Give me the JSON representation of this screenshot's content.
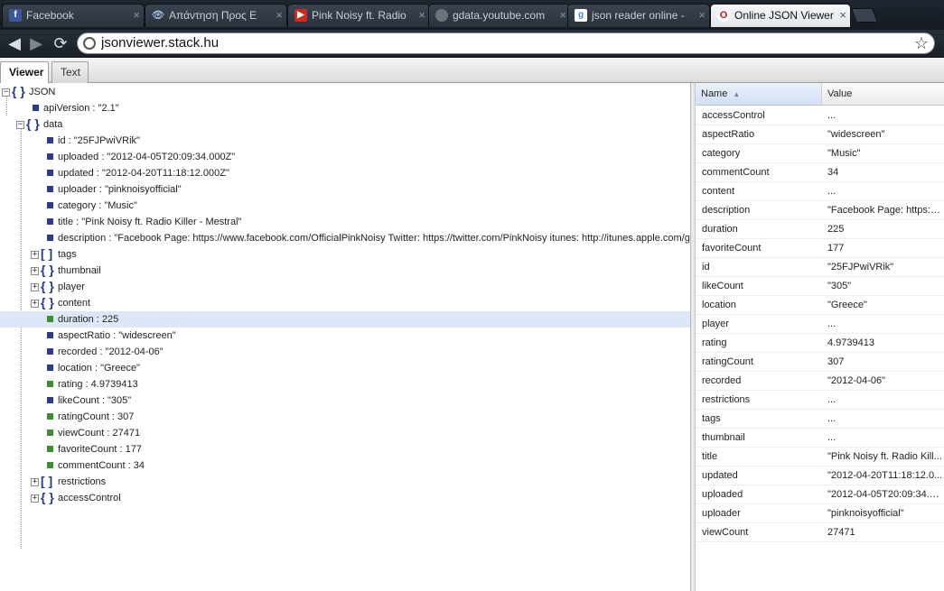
{
  "browser": {
    "tabs": [
      {
        "title": "Facebook",
        "icon": "facebook-icon"
      },
      {
        "title": "Απάντηση Προς Ε",
        "icon": "eye-icon"
      },
      {
        "title": "Pink Noisy ft. Radio",
        "icon": "youtube-icon"
      },
      {
        "title": "gdata.youtube.com",
        "icon": "globe-icon"
      },
      {
        "title": "json reader online -",
        "icon": "google-icon"
      },
      {
        "title": "Online JSON Viewer",
        "icon": "opera-icon"
      }
    ],
    "close_glyph": "×",
    "url": "jsonviewer.stack.hu"
  },
  "app": {
    "tabs": [
      {
        "label": "Viewer",
        "active": true
      },
      {
        "label": "Text",
        "active": false
      }
    ]
  },
  "tree": {
    "rows": [
      {
        "toggle": "⊟",
        "icon": "{}",
        "text": "JSON",
        "indent": 0
      },
      {
        "leaf": "str",
        "text": "apiVersion : \"2.1\"",
        "indent": 1
      },
      {
        "toggle": "⊟",
        "icon": "{}",
        "text": "data",
        "indent": 1
      },
      {
        "leaf": "str",
        "text": "id : \"25FJPwiVRik\"",
        "indent": 2
      },
      {
        "leaf": "str",
        "text": "uploaded : \"2012-04-05T20:09:34.000Z\"",
        "indent": 2
      },
      {
        "leaf": "str",
        "text": "updated : \"2012-04-20T11:18:12.000Z\"",
        "indent": 2
      },
      {
        "leaf": "str",
        "text": "uploader : \"pinknoisyofficial\"",
        "indent": 2
      },
      {
        "leaf": "str",
        "text": "category : \"Music\"",
        "indent": 2
      },
      {
        "leaf": "str",
        "text": "title : \"Pink Noisy ft. Radio Killer - Mestral\"",
        "indent": 2
      },
      {
        "leaf": "str",
        "text": "description : \"Facebook Page: https://www.facebook.com/OfficialPinkNoisy Twitter: https://twitter.com/PinkNoisy itunes: http://itunes.apple.com/gr",
        "indent": 2
      },
      {
        "toggle": "⊞",
        "icon": "[]",
        "text": "tags",
        "indent": 2
      },
      {
        "toggle": "⊞",
        "icon": "{}",
        "text": "thumbnail",
        "indent": 2
      },
      {
        "toggle": "⊞",
        "icon": "{}",
        "text": "player",
        "indent": 2
      },
      {
        "toggle": "⊞",
        "icon": "{}",
        "text": "content",
        "indent": 2
      },
      {
        "leaf": "num",
        "text": "duration : 225",
        "indent": 2,
        "selected": true
      },
      {
        "leaf": "str",
        "text": "aspectRatio : \"widescreen\"",
        "indent": 2
      },
      {
        "leaf": "str",
        "text": "recorded : \"2012-04-06\"",
        "indent": 2
      },
      {
        "leaf": "str",
        "text": "location : \"Greece\"",
        "indent": 2
      },
      {
        "leaf": "num",
        "text": "rating : 4.9739413",
        "indent": 2
      },
      {
        "leaf": "str",
        "text": "likeCount : \"305\"",
        "indent": 2
      },
      {
        "leaf": "num",
        "text": "ratingCount : 307",
        "indent": 2
      },
      {
        "leaf": "num",
        "text": "viewCount : 27471",
        "indent": 2
      },
      {
        "leaf": "num",
        "text": "favoriteCount : 177",
        "indent": 2
      },
      {
        "leaf": "num",
        "text": "commentCount : 34",
        "indent": 2
      },
      {
        "toggle": "⊞",
        "icon": "[]",
        "text": "restrictions",
        "indent": 2
      },
      {
        "toggle": "⊞",
        "icon": "{}",
        "text": "accessControl",
        "indent": 2
      }
    ]
  },
  "grid": {
    "header": {
      "name": "Name",
      "sort_glyph": "▲",
      "value": "Value"
    },
    "rows": [
      {
        "name": "accessControl",
        "value": "..."
      },
      {
        "name": "aspectRatio",
        "value": "\"widescreen\""
      },
      {
        "name": "category",
        "value": "\"Music\""
      },
      {
        "name": "commentCount",
        "value": "34"
      },
      {
        "name": "content",
        "value": "..."
      },
      {
        "name": "description",
        "value": "\"Facebook Page: https://..."
      },
      {
        "name": "duration",
        "value": "225"
      },
      {
        "name": "favoriteCount",
        "value": "177"
      },
      {
        "name": "id",
        "value": "\"25FJPwiVRik\""
      },
      {
        "name": "likeCount",
        "value": "\"305\""
      },
      {
        "name": "location",
        "value": "\"Greece\""
      },
      {
        "name": "player",
        "value": "..."
      },
      {
        "name": "rating",
        "value": "4.9739413"
      },
      {
        "name": "ratingCount",
        "value": "307"
      },
      {
        "name": "recorded",
        "value": "\"2012-04-06\""
      },
      {
        "name": "restrictions",
        "value": "..."
      },
      {
        "name": "tags",
        "value": "..."
      },
      {
        "name": "thumbnail",
        "value": "..."
      },
      {
        "name": "title",
        "value": "\"Pink Noisy ft. Radio Kill..."
      },
      {
        "name": "updated",
        "value": "\"2012-04-20T11:18:12.0..."
      },
      {
        "name": "uploaded",
        "value": "\"2012-04-05T20:09:34.0..."
      },
      {
        "name": "uploader",
        "value": "\"pinknoisyofficial\""
      },
      {
        "name": "viewCount",
        "value": "27471"
      }
    ]
  }
}
